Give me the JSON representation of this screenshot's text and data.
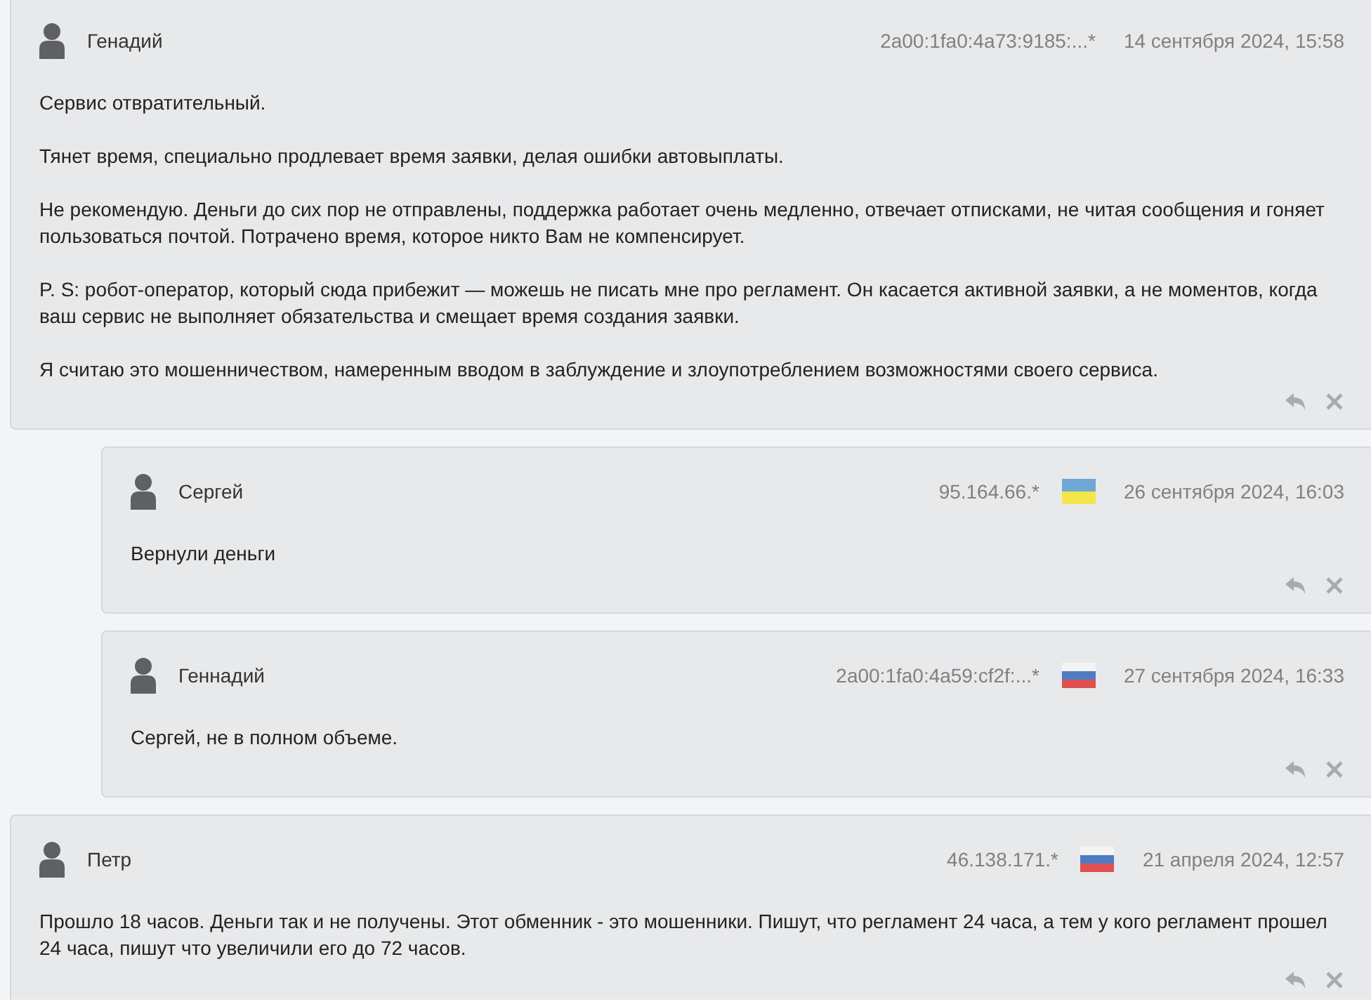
{
  "comments": [
    {
      "author": "Генадий",
      "ip": "2a00:1fa0:4a73:9185:...*",
      "date": "14 сентября 2024, 15:58",
      "reply": false,
      "paragraphs": [
        "Сервис отвратительный.",
        "Тянет время, специально продлевает время заявки, делая ошибки автовыплаты.",
        "Не рекомендую. Деньги до сих пор не отправлены, поддержка работает очень медленно, отвечает отписками, не читая сообщения и гоняет пользоваться почтой. Потрачено время, которое никто Вам не компенсирует.",
        "P. S: робот-оператор, который сюда прибежит — можешь не писать мне про регламент. Он касается активной заявки, а не моментов, когда ваш сервис не выполняет обязательства и смещает время создания заявки.",
        "Я считаю это мошенничеством, намеренным вводом в заблуждение и злоупотреблением возможностями своего сервиса."
      ]
    },
    {
      "author": "Сергей",
      "ip": "95.164.66.*",
      "flag": {
        "kind": "ua"
      },
      "date": "26 сентября 2024, 16:03",
      "reply": true,
      "paragraphs": [
        "Вернули деньги"
      ]
    },
    {
      "author": "Геннадий",
      "ip": "2a00:1fa0:4a59:cf2f:...*",
      "flag": {
        "kind": "ru"
      },
      "date": "27 сентября 2024, 16:33",
      "reply": true,
      "paragraphs": [
        "Сергей, не в полном объеме."
      ]
    },
    {
      "author": "Петр",
      "ip": "46.138.171.*",
      "flag": {
        "kind": "ru"
      },
      "date": "21 апреля 2024, 12:57",
      "reply": false,
      "paragraphs": [
        "Прошло 18 часов. Деньги так и не получены. Этот обменник - это мошенники. Пишут, что регламент 24 часа, а тем у кого регламент прошел 24 часа, пишут что увеличили его до 72 часов."
      ]
    }
  ]
}
